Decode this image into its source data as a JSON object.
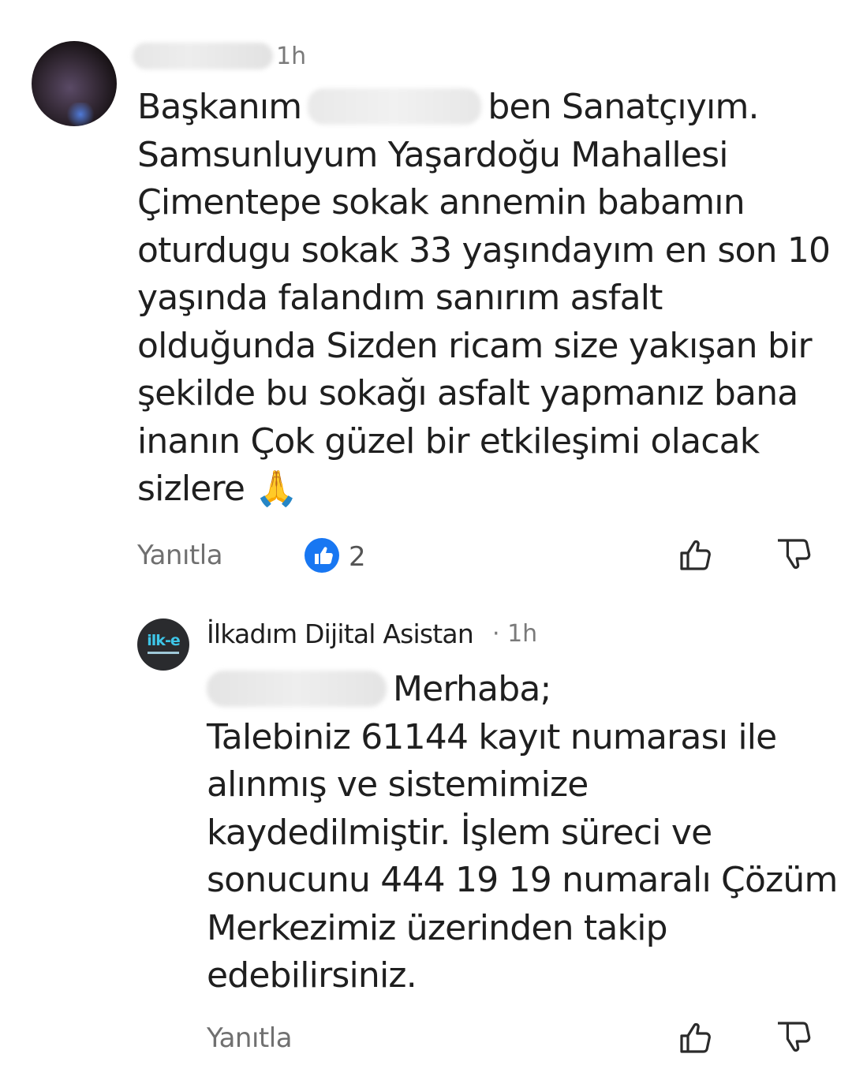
{
  "comment": {
    "time": "1h",
    "text_before_blur": "Başkanım",
    "text_after_blur": "ben Sanatçıyım. Samsunluyum Yaşardoğu Mahallesi Çimentepe sokak annemin babamın oturdugu sokak 33 yaşındayım en son 10 yaşında falandım sanırım asfalt olduğunda Sizden ricam size yakışan bir şekilde bu sokağı asfalt yapmanız bana inanın Çok güzel bir etkileşimi olacak sizlere",
    "emoji": "🙏",
    "reply_label": "Yanıtla",
    "reaction_count": "2",
    "icons": {
      "avatar": "user-avatar-blurred",
      "reaction": "facebook-like-icon",
      "like": "thumb-up-icon",
      "dislike": "thumb-down-icon"
    }
  },
  "reply": {
    "author": "İlkadım Dijital Asistan",
    "separator": "·",
    "time": "1h",
    "avatar_logo": "ilk-e",
    "greeting": "Merhaba;",
    "text": "Talebiniz 61144 kayıt numarası ile alınmış ve sistemimize kaydedilmiştir. İşlem süreci ve sonucunu  444 19 19 numaralı Çözüm Merkezimiz üzerinden takip edebilirsiniz.",
    "reply_label": "Yanıtla",
    "icons": {
      "like": "thumb-up-icon",
      "dislike": "thumb-down-icon"
    }
  },
  "colors": {
    "text": "#1f1f1f",
    "muted": "#707070",
    "like_badge": "#1877f2",
    "logo_accent": "#3ec6e8"
  }
}
